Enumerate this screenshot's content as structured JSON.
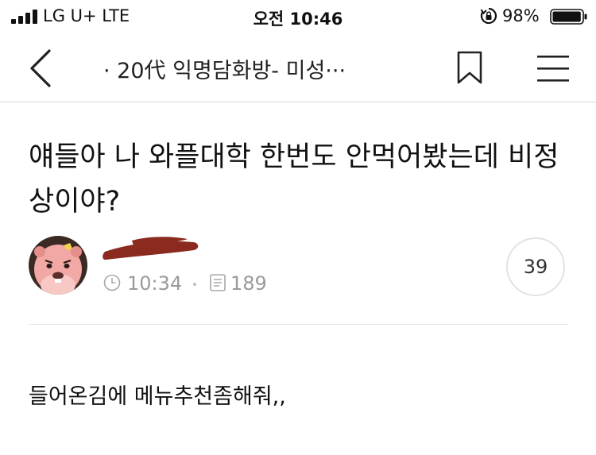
{
  "status_bar": {
    "carrier": "LG U+  LTE",
    "time": "오전 10:46",
    "battery_percent": "98%",
    "battery_level": 0.98
  },
  "nav": {
    "title": "· 20代 익명담화방- 미성···",
    "icons": [
      "back-icon",
      "bookmark-icon",
      "menu-icon"
    ]
  },
  "post": {
    "title": "얘들아 나 와플대학 한번도 안먹어봤는데 비정상이야?",
    "time": "10:34",
    "views": "189",
    "comment_count": "39",
    "body": "들어온김에 메뉴추천좀해줘,,"
  }
}
